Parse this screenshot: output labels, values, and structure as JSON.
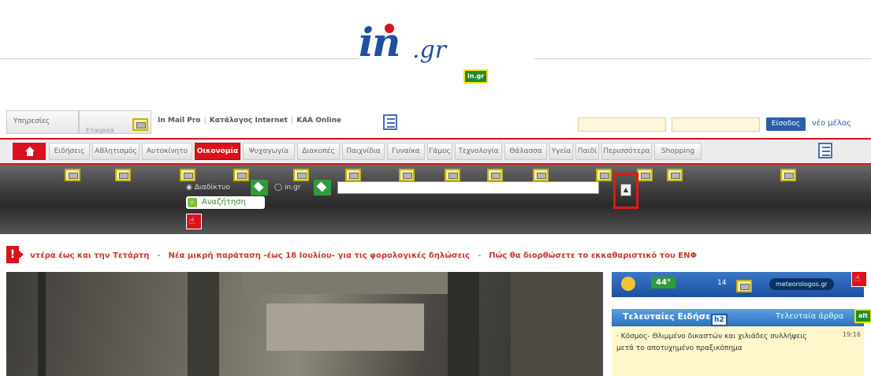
{
  "logo": {
    "main": "in",
    "suffix": ".gr",
    "alt_badge": "in.gr"
  },
  "topbar": {
    "services_label": "Υπηρεσίες",
    "tab2_label": "Εταιρικά",
    "links": [
      "In Mail Pro",
      "Κατάλογος Internet",
      "ΚΑΑ Online"
    ],
    "login_label": "Είσοδος",
    "register_label": "νέο μέλος"
  },
  "nav": {
    "tabs": [
      "Ειδήσεις",
      "Αθλητισμός",
      "Αυτοκίνητο",
      "Οικονομία",
      "Ψυχαγωγία",
      "Διακοπές",
      "Παιχνίδια",
      "Γυναίκα",
      "Γάμος",
      "Τεχνολογία",
      "Θάλασσα",
      "Υγεία",
      "Παιδί",
      "Περισσότερα",
      "Shopping"
    ],
    "active": "Οικονομία"
  },
  "search": {
    "option1": "Διαδίκτυο",
    "option2": "in.gr",
    "button_label": "Αναζήτηση"
  },
  "ticker": {
    "items": [
      "ντέρα έως και την Τετάρτη",
      "Νέα μικρή παράταση -έως 18 Ιουλίου- για τις φορολογικές δηλώσεις",
      "Πώς θα διορθώσετε το εκκαθαριστικό του ΕΝΦ"
    ]
  },
  "weather": {
    "temp": "44°",
    "humidity": "14",
    "source": "meteorologos.gr"
  },
  "latest": {
    "title": "Τελευταίες Ειδήσεις",
    "h2_tag": "h2",
    "tab2": "Τελευταία άρθρα",
    "items": [
      {
        "text": "Κόσμος- Θλιμμένο δικαστών και χιλιάδες συλλήψεις μετά το αποτυχημένο πραξικόπημα",
        "time": "19:16"
      }
    ]
  },
  "colors": {
    "brand_red": "#d9121b",
    "brand_blue": "#1f4f9e",
    "alt_green": "#1e8c2c"
  }
}
